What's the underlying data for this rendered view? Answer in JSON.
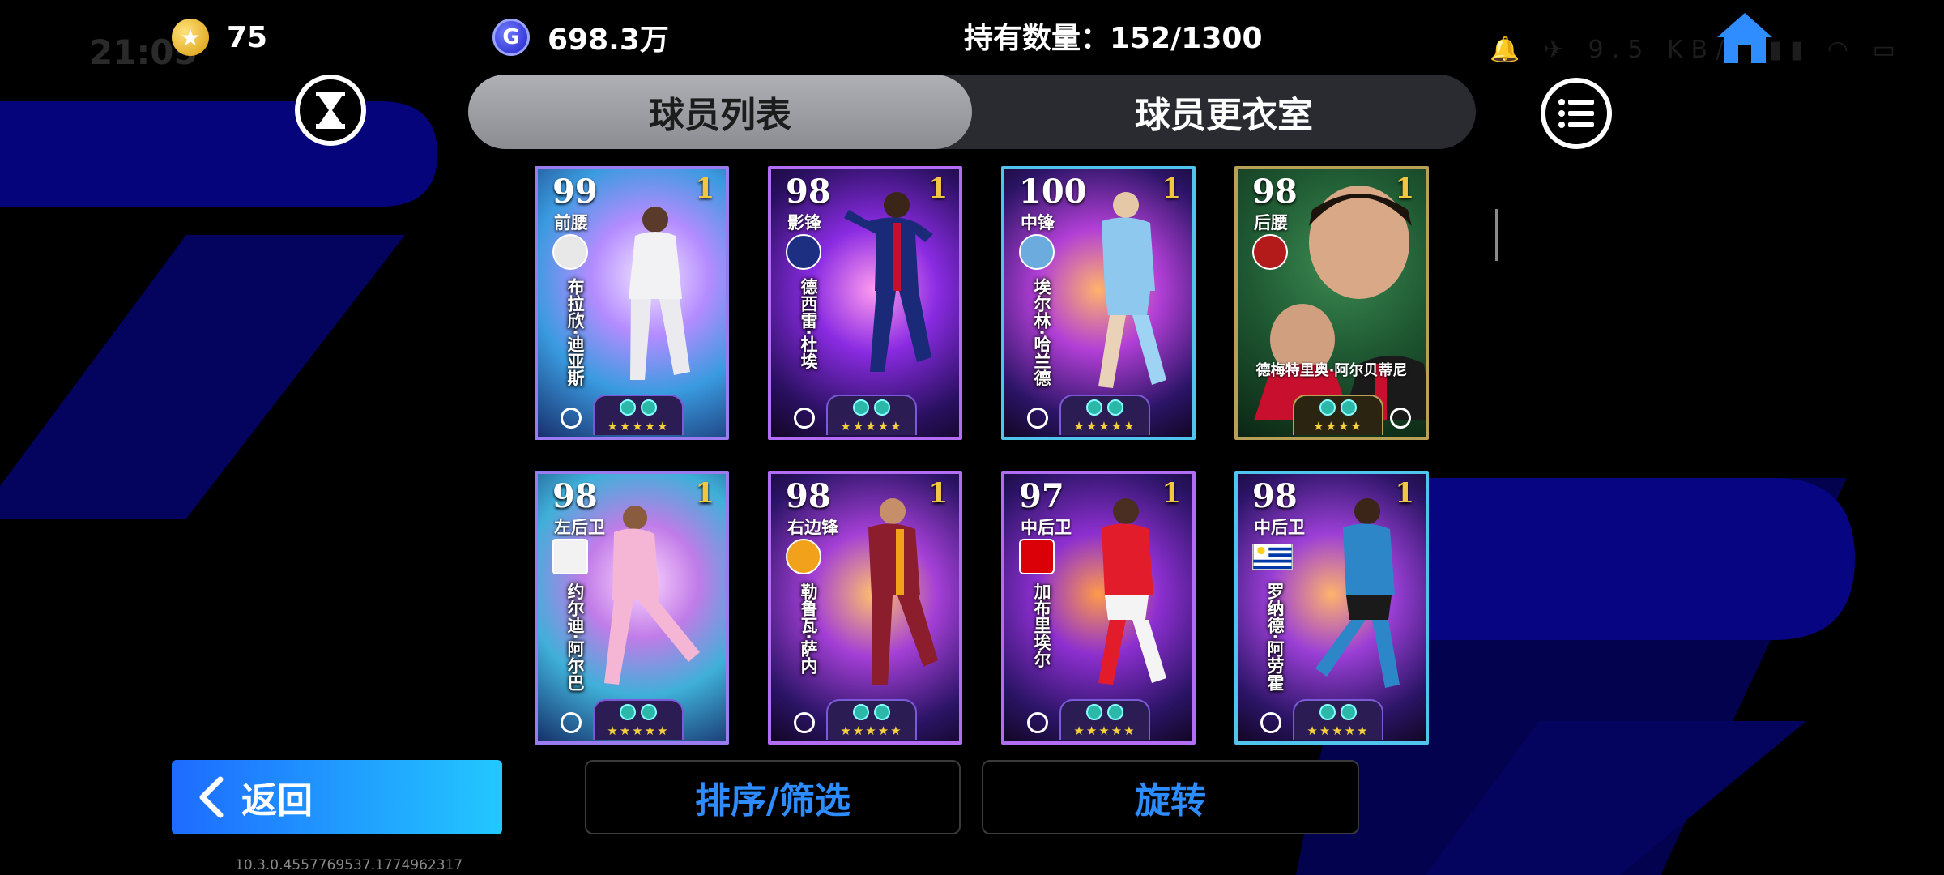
{
  "status": {
    "time": "21:05",
    "icons": "🔔 ✈ 9.5 KB/s ▮▮ ◠ ▭"
  },
  "currency": {
    "coins": "75",
    "gp": "698.3万"
  },
  "holdings": {
    "label": "持有数量：152/1300"
  },
  "tabs": [
    {
      "label": "球员列表",
      "active": true
    },
    {
      "label": "球员更衣室",
      "active": false
    }
  ],
  "cards": [
    {
      "rating": "99",
      "level": "1",
      "position": "前腰",
      "name": "布拉欣·迪亚斯",
      "name_layout": "vertical",
      "style": "cyan"
    },
    {
      "rating": "98",
      "level": "1",
      "position": "影锋",
      "name": "德西雷·杜埃",
      "name_layout": "vertical",
      "style": "purple"
    },
    {
      "rating": "100",
      "level": "1",
      "position": "中锋",
      "name": "埃尔林·哈兰德",
      "name_layout": "vertical",
      "style": "purple"
    },
    {
      "rating": "98",
      "level": "1",
      "position": "后腰",
      "name": "德梅特里奥·阿尔贝蒂尼",
      "name_layout": "horizontal",
      "style": "gold"
    },
    {
      "rating": "98",
      "level": "1",
      "position": "左后卫",
      "name": "约尔迪·阿尔巴",
      "name_layout": "vertical",
      "style": "cyan"
    },
    {
      "rating": "98",
      "level": "1",
      "position": "右边锋",
      "name": "勒鲁瓦·萨内",
      "name_layout": "vertical",
      "style": "purple"
    },
    {
      "rating": "97",
      "level": "1",
      "position": "中后卫",
      "name": "加布里埃尔",
      "name_layout": "vertical",
      "style": "purple"
    },
    {
      "rating": "98",
      "level": "1",
      "position": "中后卫",
      "name": "罗纳德·阿劳霍",
      "name_layout": "vertical",
      "style": "purple"
    }
  ],
  "buttons": {
    "back": "返回",
    "sort_filter": "排序/筛选",
    "rotate": "旋转"
  },
  "version": "10.3.0.4557769537.1774962317",
  "colors": {
    "accent_blue": "#2d8cff",
    "card_purple": "#b36df5",
    "card_gold": "#b8a056",
    "back_gradient_start": "#1e6bff"
  }
}
